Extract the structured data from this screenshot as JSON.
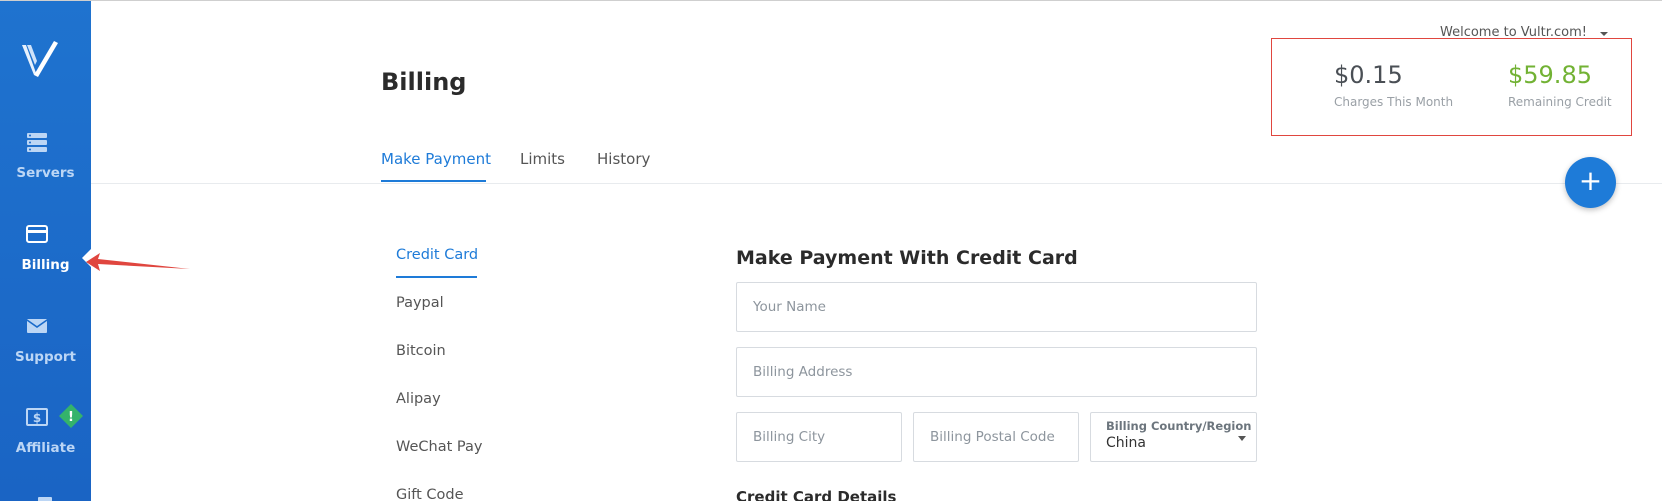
{
  "sidebar": {
    "items": [
      {
        "label": "Servers",
        "icon": "servers-icon"
      },
      {
        "label": "Billing",
        "icon": "credit-card-icon"
      },
      {
        "label": "Support",
        "icon": "envelope-icon"
      },
      {
        "label": "Affiliate",
        "icon": "dollar-icon"
      }
    ],
    "active": "Billing",
    "affiliate_badge": "!"
  },
  "header": {
    "welcome": "Welcome to Vultr.com!",
    "title": "Billing"
  },
  "stats": {
    "charges": {
      "value": "$0.15",
      "label": "Charges This Month"
    },
    "credit": {
      "value": "$59.85",
      "label": "Remaining Credit"
    }
  },
  "tabs": [
    "Make Payment",
    "Limits",
    "History"
  ],
  "fab_label": "+",
  "payment_methods": [
    "Credit Card",
    "Paypal",
    "Bitcoin",
    "Alipay",
    "WeChat Pay",
    "Gift Code"
  ],
  "form": {
    "title": "Make Payment With Credit Card",
    "name_placeholder": "Your Name",
    "address_placeholder": "Billing Address",
    "city_placeholder": "Billing City",
    "postal_placeholder": "Billing Postal Code",
    "country_label": "Billing Country/Region",
    "country_value": "China",
    "cc_heading": "Credit Card Details"
  },
  "colors": {
    "sidebar": "#1a6bcb",
    "accent": "#1e7bd8",
    "credit_green": "#72b234",
    "annotation_red": "#e0463f",
    "badge_green": "#34b36b"
  }
}
